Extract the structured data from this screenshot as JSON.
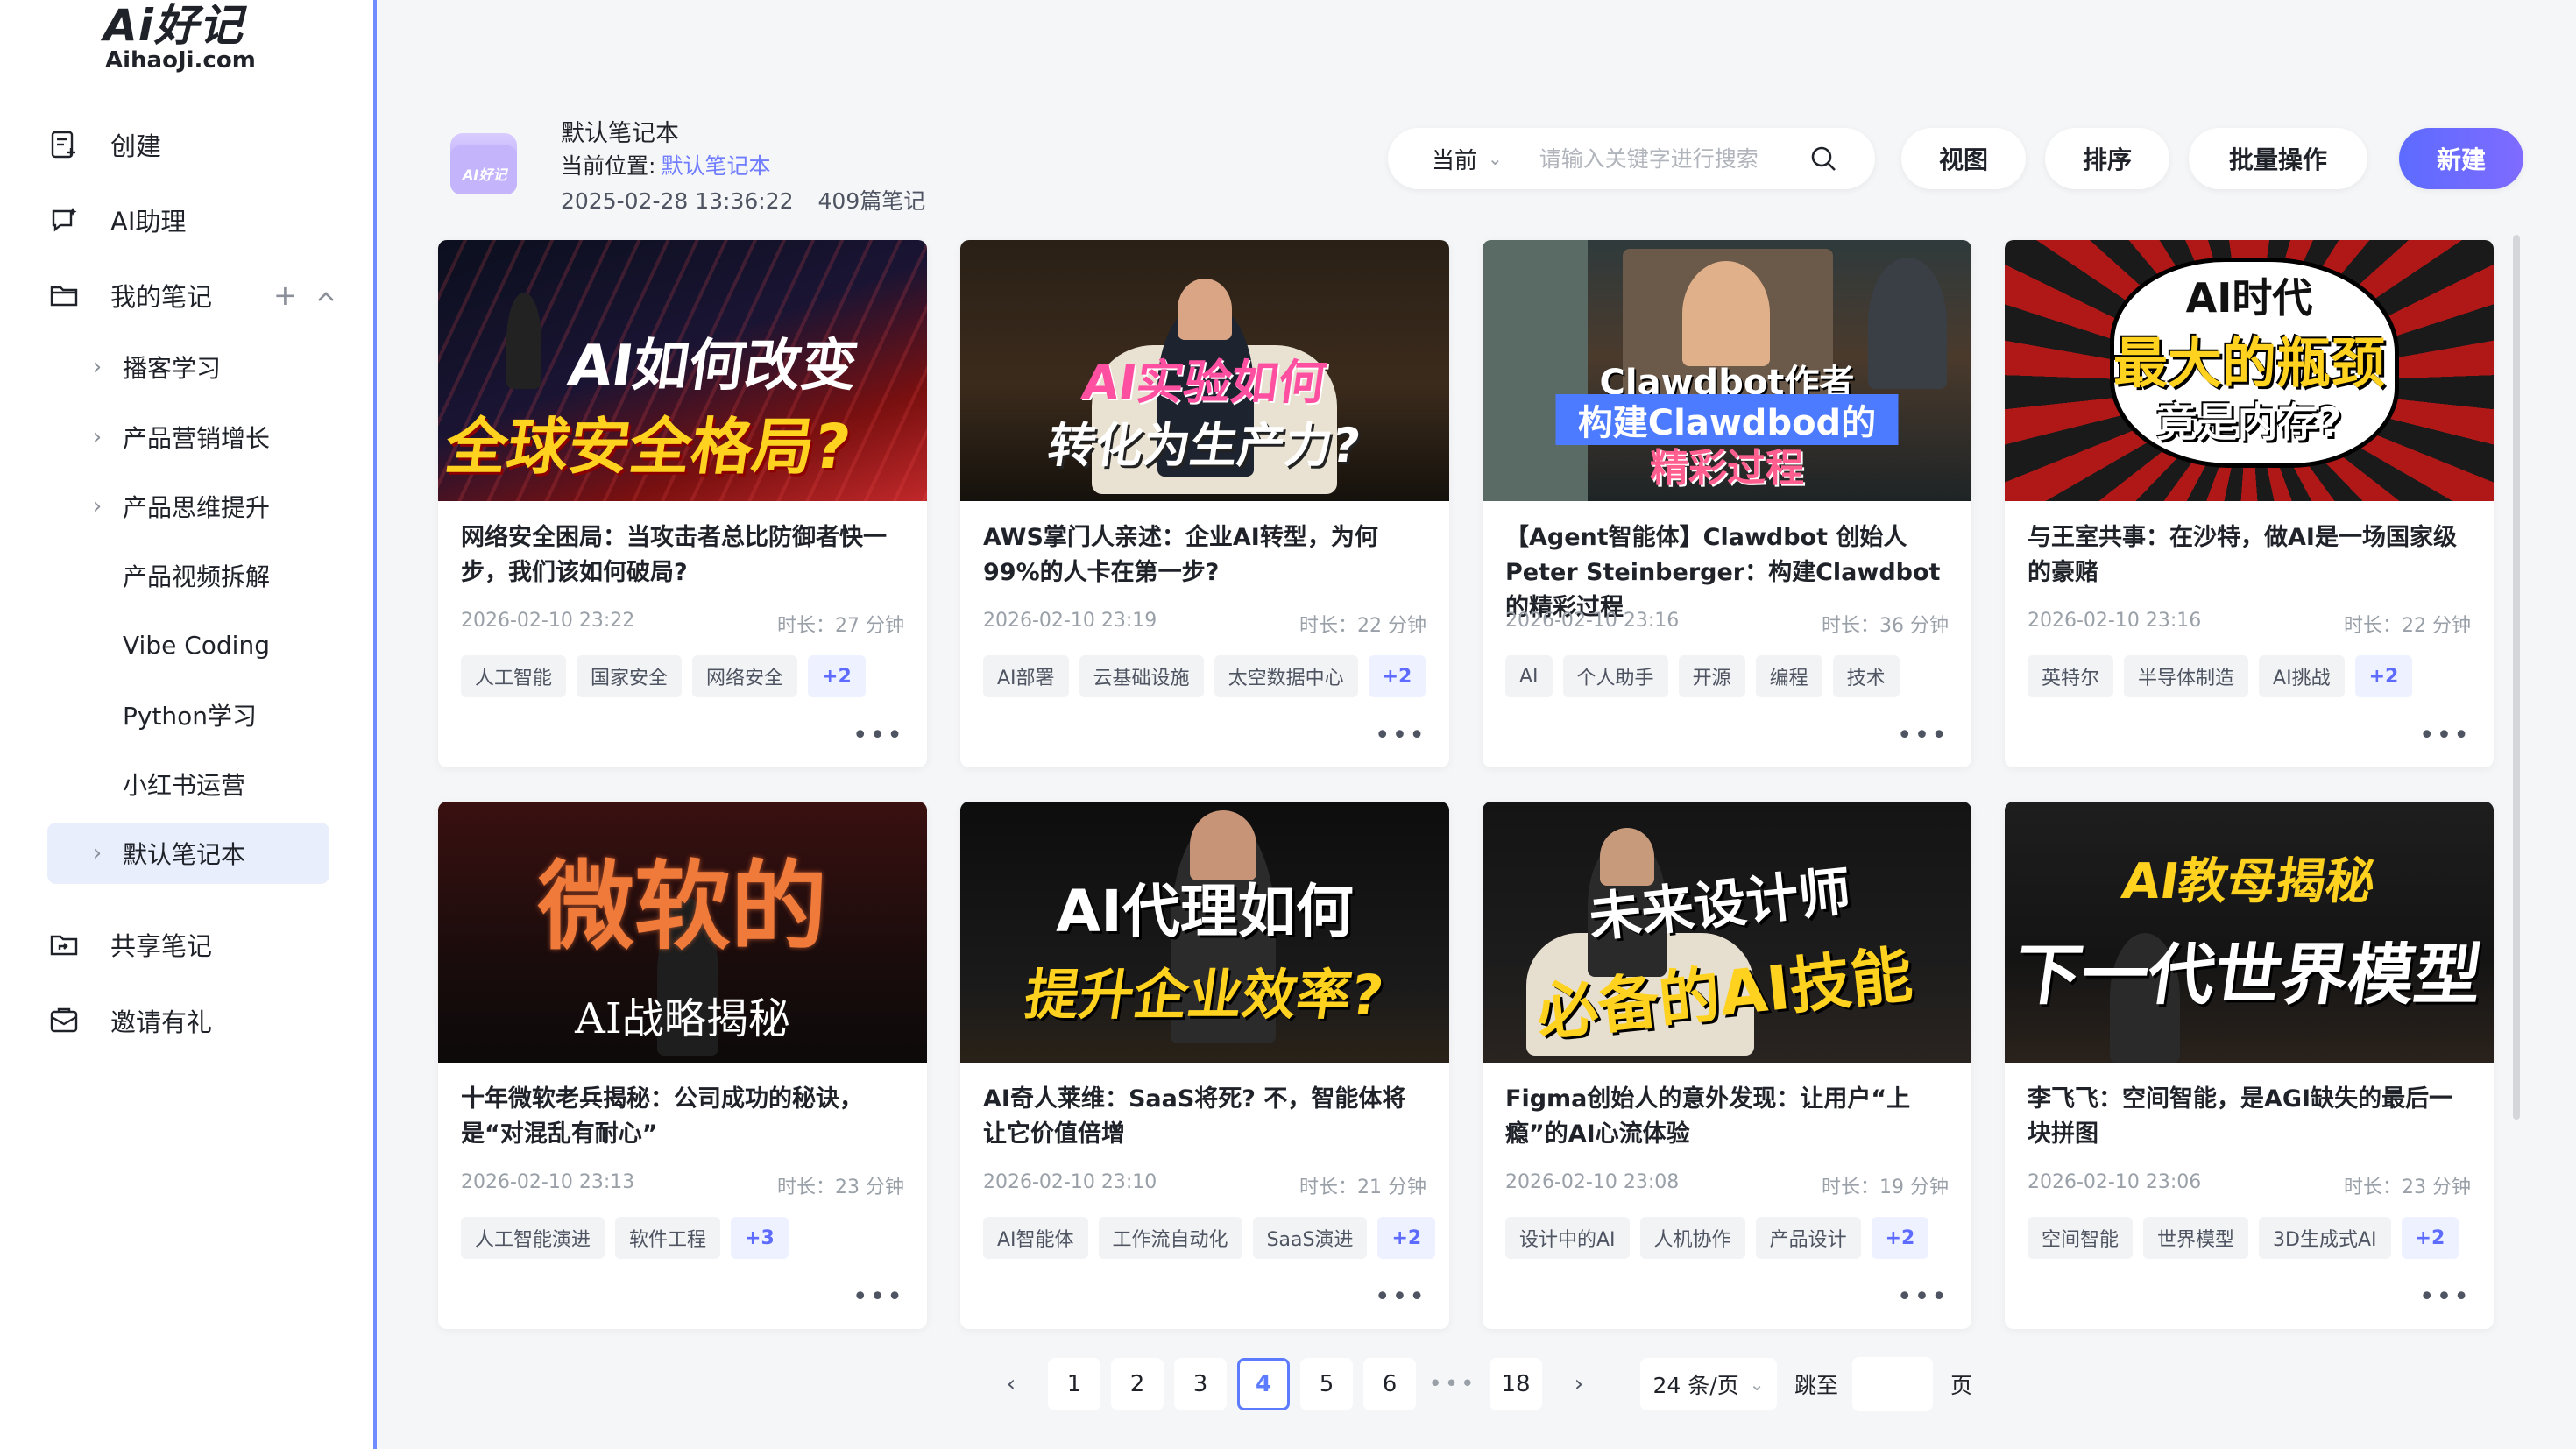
{
  "app": {
    "logo_main": "Ai好记",
    "logo_sub": "AihaoJi.com"
  },
  "sidebar": {
    "top_items": [
      {
        "label": "创建",
        "icon": "create-note-icon"
      },
      {
        "label": "AI助理",
        "icon": "ai-assistant-icon"
      },
      {
        "label": "我的笔记",
        "icon": "folder-icon"
      }
    ],
    "mynotes_tools": {
      "add": "+",
      "collapse": "⌃"
    },
    "notebooks": [
      {
        "label": "播客学习",
        "has_children": true
      },
      {
        "label": "产品营销增长",
        "has_children": true
      },
      {
        "label": "产品思维提升",
        "has_children": true
      },
      {
        "label": "产品视频拆解",
        "has_children": false
      },
      {
        "label": "Vibe Coding",
        "has_children": false
      },
      {
        "label": "Python学习",
        "has_children": false
      },
      {
        "label": "小红书运营",
        "has_children": false
      },
      {
        "label": "默认笔记本",
        "has_children": true,
        "active": true
      }
    ],
    "bottom_items": [
      {
        "label": "共享笔记",
        "icon": "shared-folder-icon"
      },
      {
        "label": "邀请有礼",
        "icon": "gift-mail-icon"
      }
    ]
  },
  "header": {
    "notebook_title": "默认笔记本",
    "location_label": "当前位置:",
    "location_link": "默认笔记本",
    "timestamp": "2025-02-28 13:36:22",
    "note_count": "409篇笔记",
    "folder_icon_text": "AI好记"
  },
  "search": {
    "scope": "当前",
    "placeholder": "请输入关键字进行搜索"
  },
  "toolbar": {
    "view": "视图",
    "sort": "排序",
    "batch": "批量操作",
    "new": "新建"
  },
  "cards": [
    {
      "title": "网络安全困局：当攻击者总比防御者快一步，我们该如何破局?",
      "date": "2026-02-10 23:22",
      "duration": "时长：27 分钟",
      "tags": [
        "人工智能",
        "国家安全",
        "网络安全"
      ],
      "more_tags": "+2",
      "thumb_line1": "AI如何改变",
      "thumb_line2": "全球安全格局?"
    },
    {
      "title": "AWS掌门人亲述：企业AI转型，为何99%的人卡在第一步?",
      "date": "2026-02-10 23:19",
      "duration": "时长：22 分钟",
      "tags": [
        "AI部署",
        "云基础设施",
        "太空数据中心"
      ],
      "more_tags": "+2",
      "thumb_line1": "AI实验如何",
      "thumb_line2": "转化为生产力?"
    },
    {
      "title": "【Agent智能体】Clawdbot 创始人 Peter Steinberger：构建Clawdbot的精彩过程",
      "date": "2026-02-10 23:16",
      "duration": "时长：36 分钟",
      "tags": [
        "AI",
        "个人助手",
        "开源",
        "编程",
        "技术"
      ],
      "more_tags": "",
      "thumb_line1": "Clawdbot作者",
      "thumb_line2": "构建Clawdbod的",
      "thumb_line3": "精彩过程"
    },
    {
      "title": "与王室共事：在沙特，做AI是一场国家级的豪赌",
      "date": "2026-02-10 23:16",
      "duration": "时长：22 分钟",
      "tags": [
        "英特尔",
        "半导体制造",
        "AI挑战"
      ],
      "more_tags": "+2",
      "thumb_line1": "AI时代",
      "thumb_line2": "最大的瓶颈",
      "thumb_line3": "竟是内存?"
    },
    {
      "title": "十年微软老兵揭秘：公司成功的秘诀，是“对混乱有耐心”",
      "date": "2026-02-10 23:13",
      "duration": "时长：23 分钟",
      "tags": [
        "人工智能演进",
        "软件工程"
      ],
      "more_tags": "+3",
      "thumb_line1": "微软的",
      "thumb_line2": "AI战略揭秘"
    },
    {
      "title": "AI奇人莱维：SaaS将死? 不，智能体将让它价值倍增",
      "date": "2026-02-10 23:10",
      "duration": "时长：21 分钟",
      "tags": [
        "AI智能体",
        "工作流自动化",
        "SaaS演进"
      ],
      "more_tags": "+2",
      "thumb_line1": "AI代理如何",
      "thumb_line2": "提升企业效率?"
    },
    {
      "title": "Figma创始人的意外发现：让用户“上瘾”的AI心流体验",
      "date": "2026-02-10 23:08",
      "duration": "时长：19 分钟",
      "tags": [
        "设计中的AI",
        "人机协作",
        "产品设计"
      ],
      "more_tags": "+2",
      "thumb_line1": "未来设计师",
      "thumb_line2": "必备的AI技能"
    },
    {
      "title": "李飞飞：空间智能，是AGI缺失的最后一块拼图",
      "date": "2026-02-10 23:06",
      "duration": "时长：23 分钟",
      "tags": [
        "空间智能",
        "世界模型",
        "3D生成式AI"
      ],
      "more_tags": "+2",
      "thumb_line1": "AI教母揭秘",
      "thumb_line2": "下一代世界模型"
    }
  ],
  "card_more": "•••",
  "pagination": {
    "prev": "‹",
    "next": "›",
    "pages": [
      "1",
      "2",
      "3",
      "4",
      "5",
      "6"
    ],
    "current": "4",
    "ellipsis": "•••",
    "last": "18",
    "page_size": "24 条/页",
    "jump_label": "跳至",
    "jump_suffix": "页"
  }
}
